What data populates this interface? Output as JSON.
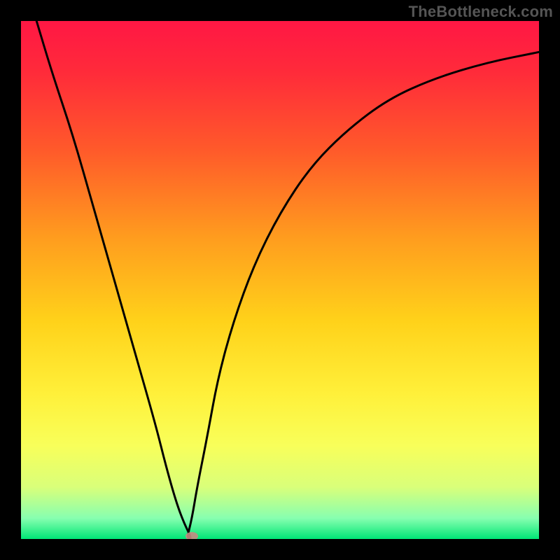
{
  "watermark": {
    "text": "TheBottleneck.com"
  },
  "colors": {
    "background": "#000000",
    "gradient_stops": [
      {
        "offset": 0.0,
        "color": "#ff1744"
      },
      {
        "offset": 0.1,
        "color": "#ff2b3a"
      },
      {
        "offset": 0.25,
        "color": "#ff5a2a"
      },
      {
        "offset": 0.42,
        "color": "#ff9d1e"
      },
      {
        "offset": 0.58,
        "color": "#ffd21a"
      },
      {
        "offset": 0.72,
        "color": "#fff03a"
      },
      {
        "offset": 0.82,
        "color": "#f8ff5a"
      },
      {
        "offset": 0.9,
        "color": "#d9ff7a"
      },
      {
        "offset": 0.96,
        "color": "#87ffb0"
      },
      {
        "offset": 1.0,
        "color": "#00e676"
      }
    ],
    "curve": "#000000",
    "marker": "#c58a82"
  },
  "chart_data": {
    "type": "line",
    "title": "",
    "xlabel": "",
    "ylabel": "",
    "xlim": [
      0,
      100
    ],
    "ylim": [
      0,
      100
    ],
    "grid": false,
    "series": [
      {
        "name": "bottleneck-curve",
        "x": [
          3,
          6,
          10,
          14,
          18,
          22,
          26,
          28,
          30,
          31.5,
          33,
          32,
          33,
          34,
          36,
          38,
          41,
          45,
          50,
          56,
          63,
          71,
          80,
          90,
          100
        ],
        "y": [
          100,
          90,
          78,
          64,
          50,
          36,
          22,
          14,
          7,
          3,
          0,
          0,
          4,
          10,
          20,
          31,
          42,
          53,
          63,
          72,
          79,
          85,
          89,
          92,
          94
        ]
      }
    ],
    "annotations": [
      {
        "name": "optimal-marker",
        "x": 33,
        "y": 0.5
      }
    ]
  }
}
